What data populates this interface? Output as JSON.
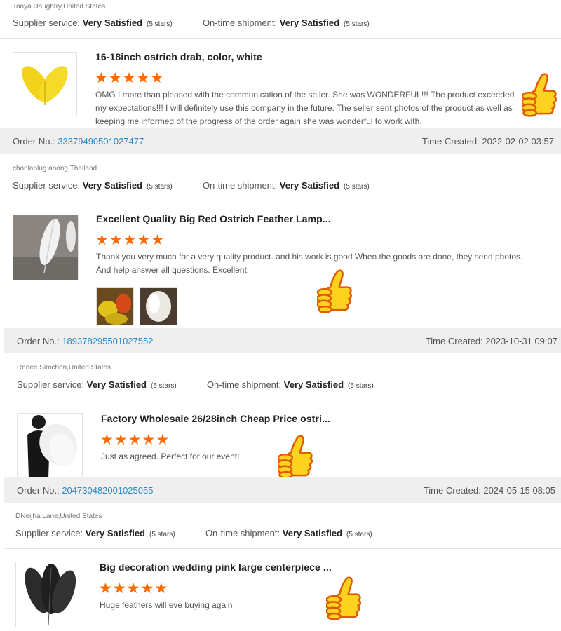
{
  "labels": {
    "supplier_service": "Supplier service:",
    "ontime_shipment": "On-time shipment:",
    "order_no": "Order No.:",
    "time_created": "Time Created:"
  },
  "reviews": [
    {
      "reviewer": "Tonya Daughtry,United States",
      "supplier_rating": "Very Satisfied",
      "supplier_stars": "(5 stars)",
      "shipment_rating": "Very Satisfied",
      "shipment_stars": "(5 stars)"
    },
    {
      "product_title": "16-18inch ostrich drab, color, white",
      "stars": 5,
      "review_text": "OMG I more than pleased with the communication of the seller. She was WONDERFUL!!! The product exceeded my expectations!!! I will definitely use this company in the future. The seller sent photos of the product as well as keeping me informed of the progress of the order again she was wonderful to work with.",
      "order_no": "33379490501027477",
      "time_created": "2022-02-02 03:57",
      "reviewer": "chonlaplug anong,Thailand",
      "supplier_rating": "Very Satisfied",
      "supplier_stars": "(5 stars)",
      "shipment_rating": "Very Satisfied",
      "shipment_stars": "(5 stars)"
    },
    {
      "product_title": "Excellent Quality Big Red Ostrich Feather Lamp...",
      "stars": 5,
      "review_text": "Thank you very much for a very quality product. and his work is good When the goods are done, they send photos. And help answer all questions. Excellent.",
      "order_no": "189378295501027552",
      "time_created": "2023-10-31 09:07",
      "reviewer": "Renee Simchon,United States",
      "supplier_rating": "Very Satisfied",
      "supplier_stars": "(5 stars)",
      "shipment_rating": "Very Satisfied",
      "shipment_stars": "(5 stars)"
    },
    {
      "product_title": "Factory Wholesale 26/28inch Cheap Price ostri...",
      "stars": 5,
      "review_text": "Just as agreed. Perfect for our event!",
      "order_no": "204730482001025055",
      "time_created": "2024-05-15 08:05",
      "reviewer": "DNeijha Lane,United States",
      "supplier_rating": "Very Satisfied",
      "supplier_stars": "(5 stars)",
      "shipment_rating": "Very Satisfied",
      "shipment_stars": "(5 stars)"
    },
    {
      "product_title": "Big decoration wedding pink large centerpiece ...",
      "stars": 5,
      "review_text": "Huge feathers will eve buying again"
    }
  ],
  "colors": {
    "star": "#ff6a00",
    "order_link": "#2d8ac7",
    "order_bar_bg": "#efefef",
    "thumbs_up": "#ffd21f"
  },
  "icons": {
    "star": "star-icon",
    "thumbs_up": "thumbs-up-icon"
  }
}
